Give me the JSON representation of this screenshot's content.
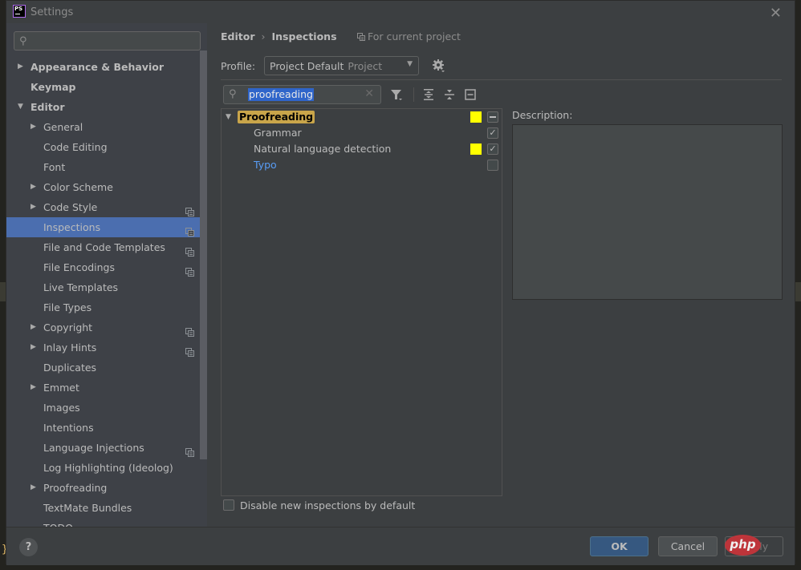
{
  "window": {
    "title": "Settings",
    "app_logo_text": "PS"
  },
  "sidebar": {
    "search": {
      "value": "",
      "placeholder": ""
    },
    "items": [
      {
        "label": "Appearance & Behavior",
        "level": 0,
        "expandable": true,
        "expanded": false,
        "project_scope": false
      },
      {
        "label": "Keymap",
        "level": 0,
        "expandable": false,
        "project_scope": false
      },
      {
        "label": "Editor",
        "level": 0,
        "expandable": true,
        "expanded": true,
        "project_scope": false
      },
      {
        "label": "General",
        "level": 1,
        "expandable": true,
        "expanded": false,
        "project_scope": false
      },
      {
        "label": "Code Editing",
        "level": 1,
        "expandable": false,
        "project_scope": false
      },
      {
        "label": "Font",
        "level": 1,
        "expandable": false,
        "project_scope": false
      },
      {
        "label": "Color Scheme",
        "level": 1,
        "expandable": true,
        "expanded": false,
        "project_scope": false
      },
      {
        "label": "Code Style",
        "level": 1,
        "expandable": true,
        "expanded": false,
        "project_scope": true
      },
      {
        "label": "Inspections",
        "level": 1,
        "expandable": false,
        "project_scope": true,
        "selected": true
      },
      {
        "label": "File and Code Templates",
        "level": 1,
        "expandable": false,
        "project_scope": true
      },
      {
        "label": "File Encodings",
        "level": 1,
        "expandable": false,
        "project_scope": true
      },
      {
        "label": "Live Templates",
        "level": 1,
        "expandable": false,
        "project_scope": false
      },
      {
        "label": "File Types",
        "level": 1,
        "expandable": false,
        "project_scope": false
      },
      {
        "label": "Copyright",
        "level": 1,
        "expandable": true,
        "expanded": false,
        "project_scope": true
      },
      {
        "label": "Inlay Hints",
        "level": 1,
        "expandable": true,
        "expanded": false,
        "project_scope": true
      },
      {
        "label": "Duplicates",
        "level": 1,
        "expandable": false,
        "project_scope": false
      },
      {
        "label": "Emmet",
        "level": 1,
        "expandable": true,
        "expanded": false,
        "project_scope": false
      },
      {
        "label": "Images",
        "level": 1,
        "expandable": false,
        "project_scope": false
      },
      {
        "label": "Intentions",
        "level": 1,
        "expandable": false,
        "project_scope": false
      },
      {
        "label": "Language Injections",
        "level": 1,
        "expandable": false,
        "project_scope": true
      },
      {
        "label": "Log Highlighting (Ideolog)",
        "level": 1,
        "expandable": false,
        "project_scope": false
      },
      {
        "label": "Proofreading",
        "level": 1,
        "expandable": true,
        "expanded": false,
        "project_scope": false
      },
      {
        "label": "TextMate Bundles",
        "level": 1,
        "expandable": false,
        "project_scope": false
      },
      {
        "label": "TODO",
        "level": 1,
        "expandable": false,
        "project_scope": false,
        "partially_visible": true
      }
    ],
    "help_label": "?"
  },
  "main": {
    "breadcrumb": [
      "Editor",
      "Inspections"
    ],
    "breadcrumb_separator": "›",
    "for_current_project": "For current project",
    "profile": {
      "label": "Profile:",
      "value": "Project Default",
      "value_scope": "Project"
    },
    "inspection_search": {
      "value": "proofreading"
    },
    "toolbar": [
      "filter-icon",
      "expand-all-icon",
      "collapse-all-icon",
      "reset-icon"
    ],
    "inspections": [
      {
        "label": "Proofreading",
        "type": "group",
        "expanded": true,
        "severity_color": "#ffff00",
        "state": "partial"
      },
      {
        "label": "Grammar",
        "type": "child",
        "severity_color": null,
        "state": "checked"
      },
      {
        "label": "Natural language detection",
        "type": "child",
        "severity_color": "#ffff00",
        "state": "checked"
      },
      {
        "label": "Typo",
        "type": "child",
        "modified": true,
        "severity_color": null,
        "state": "unchecked"
      }
    ],
    "description_label": "Description:",
    "description_text": "",
    "disable_new_label": "Disable new inspections by default",
    "disable_new_checked": false
  },
  "footer": {
    "ok_label": "OK",
    "cancel_label": "Cancel",
    "apply_label": "Apply",
    "watermark_text": "php"
  },
  "colors": {
    "selection": "#4b6eaf",
    "search_highlight": "#2f65ca",
    "group_highlight": "#c9a54a",
    "severity_weak_warning": "#ffff00",
    "modified_link": "#589df6",
    "ok_button": "#365880"
  }
}
